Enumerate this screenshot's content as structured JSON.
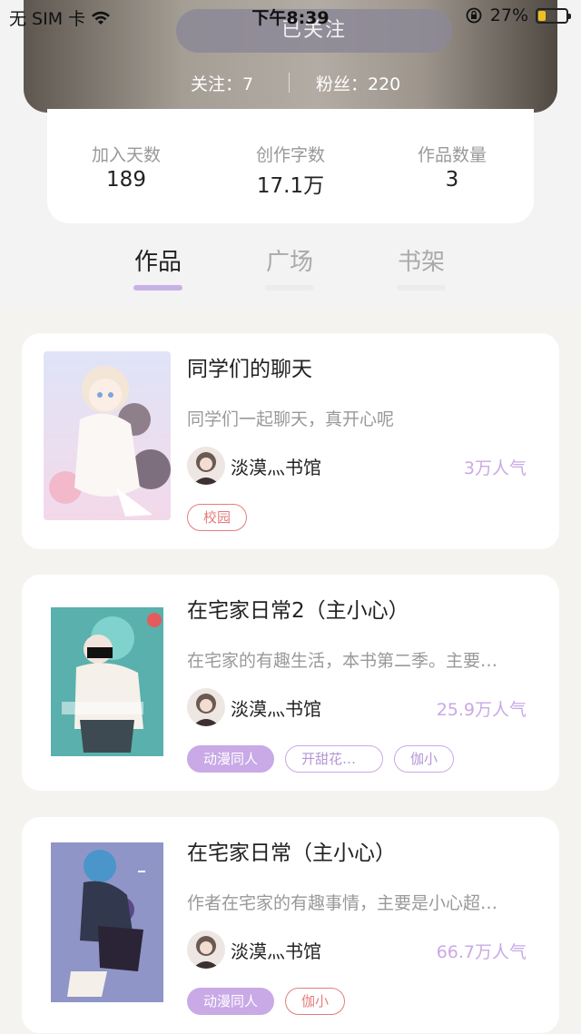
{
  "status_bar": {
    "carrier": "无 SIM 卡",
    "time": "下午8:39",
    "battery": "27%",
    "battery_level": 0.27
  },
  "profile": {
    "follow_button": "已关注",
    "following": "关注：7",
    "fans": "粉丝：220"
  },
  "stats": [
    {
      "label": "加入天数",
      "value": "189"
    },
    {
      "label": "创作字数",
      "value": "17.1万"
    },
    {
      "label": "作品数量",
      "value": "3"
    }
  ],
  "tabs": [
    {
      "label": "作品",
      "active": true
    },
    {
      "label": "广场",
      "active": false
    },
    {
      "label": "书架",
      "active": false
    }
  ],
  "books": [
    {
      "title": "同学们的聊天",
      "desc": "同学们一起聊天，真开心呢",
      "author": "淡漠灬书馆",
      "popularity": "3万人气",
      "tags": [
        {
          "text": "校园",
          "style": "red"
        }
      ]
    },
    {
      "title": "在宅家日常2（主小心）",
      "desc": "在宅家的有趣生活，本书第二季。主要…",
      "author": "淡漠灬书馆",
      "popularity": "25.9万人气",
      "tags": [
        {
          "text": "动漫同人",
          "style": "purple-fill"
        },
        {
          "text": "开甜花粗…",
          "style": "purple"
        },
        {
          "text": "伽小",
          "style": "purple"
        }
      ]
    },
    {
      "title": "在宅家日常（主小心）",
      "desc": "作者在宅家的有趣事情，主要是小心超…",
      "author": "淡漠灬书馆",
      "popularity": "66.7万人气",
      "tags": [
        {
          "text": "动漫同人",
          "style": "purple-fill"
        },
        {
          "text": "伽小",
          "style": "red"
        }
      ]
    }
  ],
  "colors": {
    "accent_purple": "#c9a9e6",
    "tag_red": "#e57c7c"
  }
}
